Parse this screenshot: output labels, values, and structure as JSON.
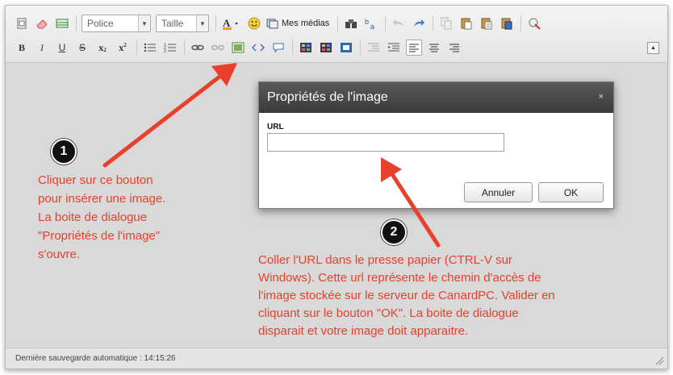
{
  "toolbar": {
    "font_select": "Police",
    "size_select": "Taille",
    "medias_label": "Mes médias",
    "bold_label": "B",
    "italic_label": "I",
    "underline_label": "U",
    "strike_label": "S",
    "subscript_label": "x",
    "superscript_label": "x"
  },
  "dialog": {
    "title": "Propriétés de l'image",
    "close_label": "×",
    "url_label": "URL",
    "url_value": "",
    "cancel_label": "Annuler",
    "ok_label": "OK"
  },
  "annotations": {
    "step1": "1",
    "step2": "2",
    "note1_lines": [
      "Cliquer sur ce bouton",
      "pour insérer une image.",
      "La boite de dialogue",
      "\"Propriétés de l'image\"",
      "s'ouvre."
    ],
    "note2_lines": [
      "Coller l'URL dans le presse papier (CTRL-V sur",
      "Windows). Cette url représente le chemin d'accès de",
      "l'image stockée sur le serveur de CanardPC. Valider en",
      "cliquant sur le bouton \"OK\". La boite de dialogue",
      "disparait et votre image doit apparaitre."
    ],
    "color": "#e8402c"
  },
  "status": {
    "autosave": "Dernière sauvegarde automatique : 14:15:26"
  }
}
